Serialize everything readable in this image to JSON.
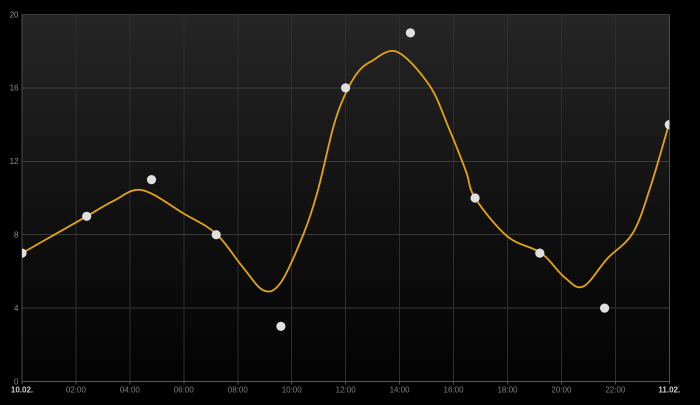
{
  "colors": {
    "page_background": "#000000",
    "plot_gradient_top": "#262626",
    "plot_gradient_mid": "#121212",
    "plot_gradient_bottom": "#030303",
    "grid_vertical": "#2e2e2e",
    "grid_horizontal": "#3a3a3a",
    "plot_edge": "#4d4d4d",
    "axis_line": "#5a5a5a",
    "tick_mark": "#4f4f4f",
    "line": "#e2a412",
    "marker": "#e0e0e0",
    "y_label": "#8f8f8f",
    "x_time_label": "#7f7f7f",
    "x_date_label": "#cecece"
  },
  "chart_data": {
    "type": "line+scatter",
    "title": "",
    "x_axis": {
      "kind": "time",
      "range_hours": [
        0,
        24
      ],
      "tick_interval_hours": 2,
      "ticks": [
        {
          "t": 0,
          "label": "10.02.",
          "emphasis": true
        },
        {
          "t": 2,
          "label": "02:00",
          "emphasis": false
        },
        {
          "t": 4,
          "label": "04:00",
          "emphasis": false
        },
        {
          "t": 6,
          "label": "06:00",
          "emphasis": false
        },
        {
          "t": 8,
          "label": "08:00",
          "emphasis": false
        },
        {
          "t": 10,
          "label": "10:00",
          "emphasis": false
        },
        {
          "t": 12,
          "label": "12:00",
          "emphasis": false
        },
        {
          "t": 14,
          "label": "14:00",
          "emphasis": false
        },
        {
          "t": 16,
          "label": "16:00",
          "emphasis": false
        },
        {
          "t": 18,
          "label": "18:00",
          "emphasis": false
        },
        {
          "t": 20,
          "label": "20:00",
          "emphasis": false
        },
        {
          "t": 22,
          "label": "22:00",
          "emphasis": false
        },
        {
          "t": 24,
          "label": "11.02.",
          "emphasis": true
        }
      ]
    },
    "y_axis": {
      "range": [
        0,
        20
      ],
      "ticks": [
        0,
        4,
        8,
        12,
        16,
        20
      ],
      "grid": true
    },
    "series": [
      {
        "name": "observed-points",
        "type": "scatter",
        "marker_radius": 4.6,
        "points": [
          [
            0,
            7
          ],
          [
            2.4,
            9
          ],
          [
            4.8,
            11
          ],
          [
            7.2,
            8
          ],
          [
            9.6,
            3
          ],
          [
            12,
            16
          ],
          [
            14.4,
            19
          ],
          [
            16.8,
            10
          ],
          [
            19.2,
            7
          ],
          [
            21.6,
            4
          ],
          [
            24,
            14
          ]
        ]
      },
      {
        "name": "smoothed-curve",
        "type": "line",
        "stroke_width": 1.8,
        "points": [
          [
            0,
            7.0
          ],
          [
            1.2,
            8.0
          ],
          [
            2.4,
            9.0
          ],
          [
            3.4,
            9.85
          ],
          [
            4.45,
            10.43
          ],
          [
            6.0,
            9.15
          ],
          [
            7.2,
            8.05
          ],
          [
            8.15,
            6.3
          ],
          [
            8.95,
            4.97
          ],
          [
            9.6,
            5.4
          ],
          [
            10.4,
            7.9
          ],
          [
            10.95,
            10.3
          ],
          [
            11.55,
            13.9
          ],
          [
            12.0,
            15.7
          ],
          [
            12.45,
            16.85
          ],
          [
            12.95,
            17.45
          ],
          [
            13.9,
            17.97
          ],
          [
            15.1,
            16.15
          ],
          [
            15.8,
            13.9
          ],
          [
            16.45,
            11.5
          ],
          [
            16.8,
            10.0
          ],
          [
            18.0,
            7.9
          ],
          [
            19.25,
            7.0
          ],
          [
            20.1,
            5.7
          ],
          [
            20.8,
            5.17
          ],
          [
            21.7,
            6.7
          ],
          [
            22.65,
            8.1
          ],
          [
            23.3,
            10.6
          ],
          [
            24,
            14.1
          ]
        ]
      }
    ],
    "legend": []
  }
}
